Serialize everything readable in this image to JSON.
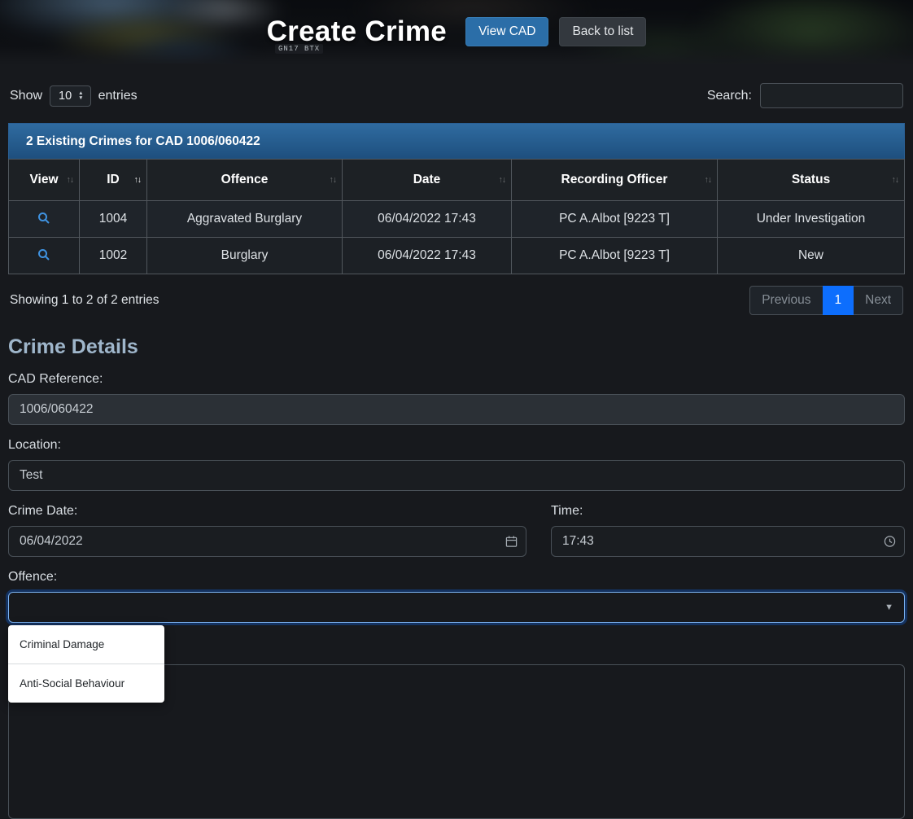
{
  "header": {
    "title": "Create Crime",
    "buttons": {
      "view_cad": "View CAD",
      "back_to_list": "Back to list"
    },
    "image_plate": "GN17 BTX"
  },
  "controls": {
    "show_label": "Show",
    "page_size": "10",
    "entries_label": "entries",
    "search_label": "Search:",
    "search_value": ""
  },
  "panel": {
    "title": "2 Existing Crimes for CAD 1006/060422"
  },
  "table": {
    "columns": [
      "View",
      "ID",
      "Offence",
      "Date",
      "Recording Officer",
      "Status"
    ],
    "rows": [
      {
        "id": "1004",
        "offence": "Aggravated Burglary",
        "date": "06/04/2022 17:43",
        "recording_officer": "PC A.Albot [9223 T]",
        "status": "Under Investigation"
      },
      {
        "id": "1002",
        "offence": "Burglary",
        "date": "06/04/2022 17:43",
        "recording_officer": "PC A.Albot [9223 T]",
        "status": "New"
      }
    ],
    "footer": {
      "info": "Showing 1 to 2 of 2 entries",
      "previous": "Previous",
      "current_page": "1",
      "next": "Next"
    }
  },
  "form": {
    "section_title": "Crime Details",
    "cad_reference": {
      "label": "CAD Reference:",
      "value": "1006/060422"
    },
    "location": {
      "label": "Location:",
      "value": "Test"
    },
    "crime_date": {
      "label": "Crime Date:",
      "value": "06/04/2022"
    },
    "time": {
      "label": "Time:",
      "value": "17:43"
    },
    "offence": {
      "label": "Offence:",
      "selected": "",
      "options": [
        "Criminal Damage",
        "Anti-Social Behaviour"
      ]
    }
  },
  "icons": {
    "sort": "↑↓",
    "caret_down": "▼",
    "spinner_up": "▲",
    "spinner_down": "▼"
  },
  "colors": {
    "page_background": "#17191d",
    "accent_blue": "#0d6efd",
    "panel_gradient_top": "#2f6ba0",
    "panel_gradient_bottom": "#1e4f7e",
    "view_cad_button": "#2b6ea8",
    "focus_border": "#7cb2f0",
    "magnifier_icon": "#3f92e0"
  }
}
